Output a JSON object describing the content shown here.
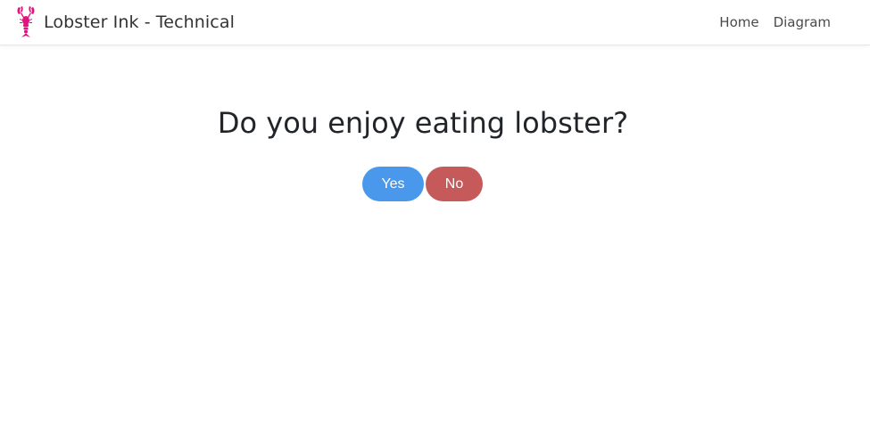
{
  "navbar": {
    "brand_text": "Lobster Ink - Technical",
    "logo_icon": "lobster-icon",
    "logo_color": "#e0137f",
    "links": [
      {
        "label": "Home"
      },
      {
        "label": "Diagram"
      }
    ]
  },
  "main": {
    "question": "Do you enjoy eating lobster?",
    "yes_label": "Yes",
    "no_label": "No",
    "yes_color": "#4a98ec",
    "no_color": "#c65a5a"
  }
}
